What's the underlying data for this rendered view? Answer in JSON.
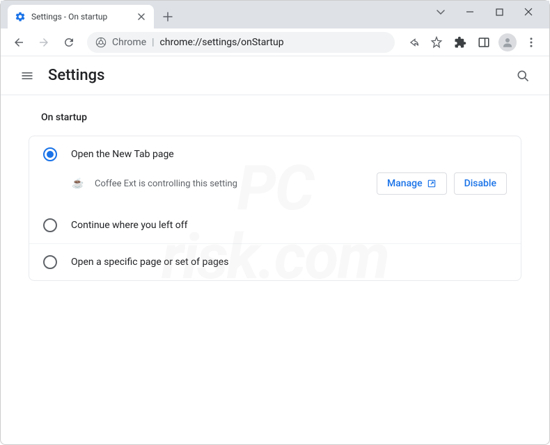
{
  "tab": {
    "title": "Settings - On startup"
  },
  "omnibox": {
    "host": "Chrome",
    "path": "chrome://settings/onStartup"
  },
  "settings": {
    "title": "Settings",
    "section": "On startup",
    "options": [
      {
        "label": "Open the New Tab page",
        "selected": true
      },
      {
        "label": "Continue where you left off",
        "selected": false
      },
      {
        "label": "Open a specific page or set of pages",
        "selected": false
      }
    ],
    "extension": {
      "message": "Coffee Ext is controlling this setting",
      "manage": "Manage",
      "disable": "Disable",
      "icon": "☕"
    }
  },
  "watermark": "PC\nrisk.com"
}
